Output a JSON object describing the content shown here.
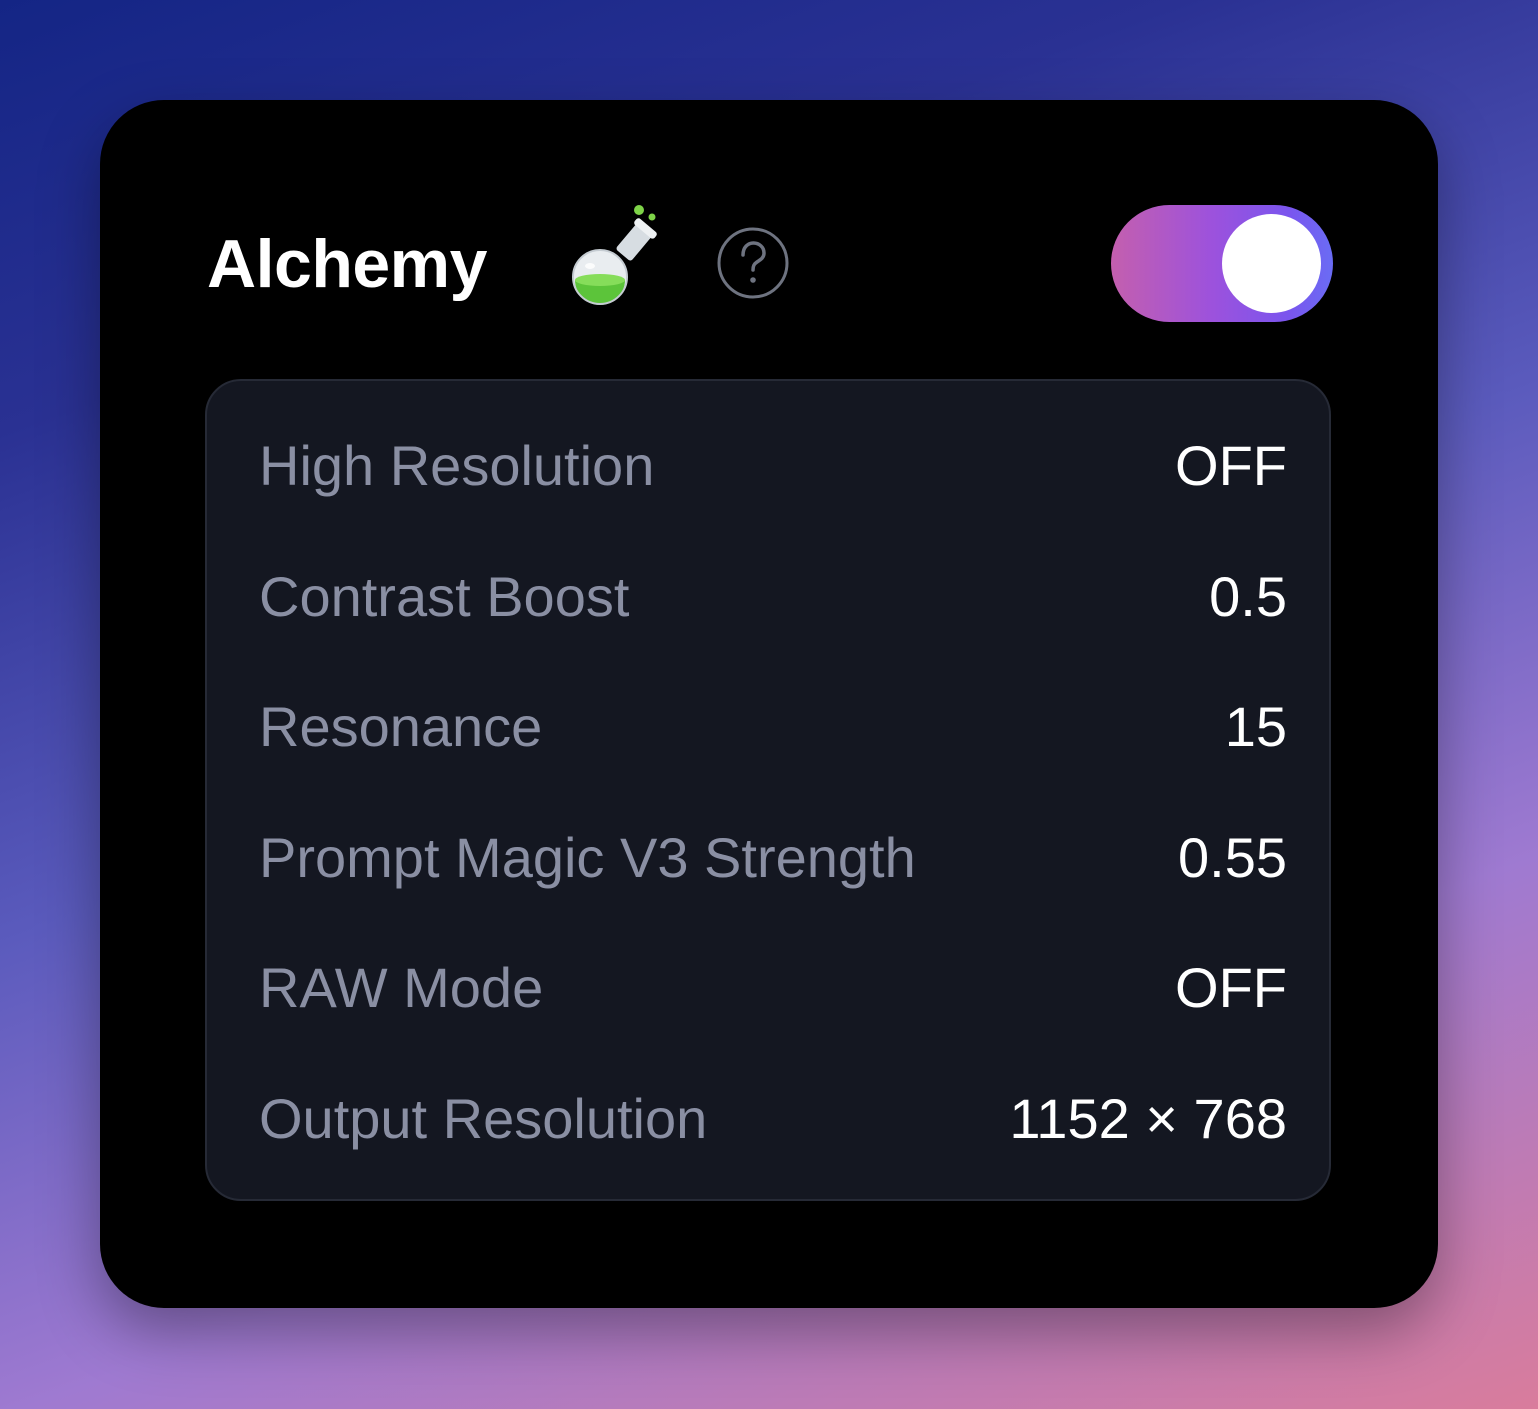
{
  "panel": {
    "title": "Alchemy",
    "title_icon": "flask-icon",
    "help_icon": "question-circle-icon",
    "toggle": {
      "state": "on",
      "gradient_colors": [
        "#c45fae",
        "#9d52dc",
        "#6a6cf4"
      ]
    }
  },
  "settings": [
    {
      "label": "High Resolution",
      "value": "OFF"
    },
    {
      "label": "Contrast Boost",
      "value": "0.5"
    },
    {
      "label": "Resonance",
      "value": "15"
    },
    {
      "label": "Prompt Magic V3 Strength",
      "value": "0.55"
    },
    {
      "label": "RAW Mode",
      "value": "OFF"
    },
    {
      "label": "Output Resolution",
      "value": "1152 × 768"
    }
  ]
}
